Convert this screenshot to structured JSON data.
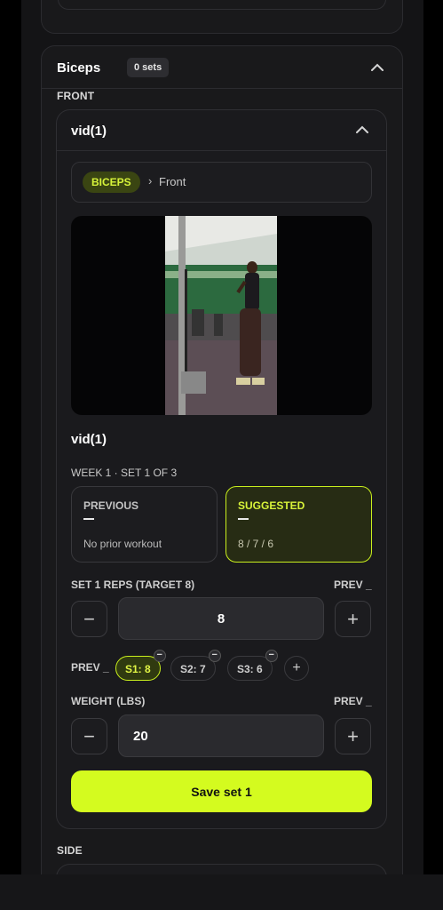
{
  "section": {
    "title": "Biceps",
    "sets_badge": "0 sets"
  },
  "groups": {
    "front_label": "FRONT",
    "side_label": "SIDE"
  },
  "card": {
    "title": "vid(1)",
    "breadcrumb": {
      "pill": "BICEPS",
      "sep": "›",
      "sub": "Front"
    },
    "video_name": "vid(1)",
    "week_label": "WEEK 1 · SET 1 OF 3",
    "previous": {
      "title": "PREVIOUS",
      "dash": "—",
      "text": "No prior workout"
    },
    "suggested": {
      "title": "SUGGESTED",
      "dash": "—",
      "text": "8 / 7 / 6"
    },
    "reps": {
      "label": "SET 1 REPS (TARGET 8)",
      "prev": "PREV _",
      "value": "8",
      "minus": "−",
      "plus": "+"
    },
    "chips": {
      "prev": "PREV _",
      "items": [
        "S1: 8",
        "S2: 7",
        "S3: 6"
      ],
      "remove": "−",
      "add": "+"
    },
    "weight": {
      "label": "WEIGHT (LBS)",
      "prev": "PREV _",
      "value": "20",
      "minus": "−",
      "plus": "+"
    },
    "save_label": "Save set 1"
  },
  "colors": {
    "accent": "#d4fb1f",
    "bg": "#141416"
  },
  "icons": {
    "collapse": "chevron-up-icon"
  }
}
